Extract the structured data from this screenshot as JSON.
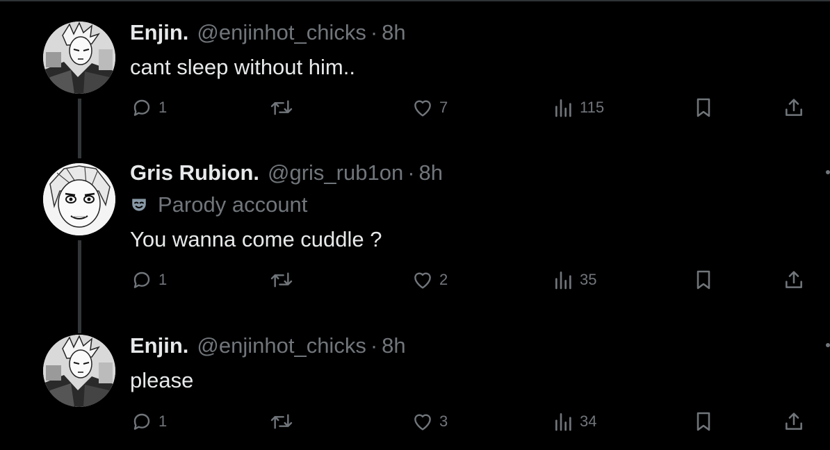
{
  "tweets": [
    {
      "name": "Enjin.",
      "handle": "@enjinhot_chicks",
      "separator": "·",
      "time": "8h",
      "text": "cant sleep without him..",
      "replies": "1",
      "likes": "7",
      "views": "115",
      "avatar": "enjin-avatar"
    },
    {
      "name": "Gris Rubion.",
      "handle": "@gris_rub1on",
      "separator": "·",
      "time": "8h",
      "badge": "Parody account",
      "text": "You wanna come cuddle ?",
      "replies": "1",
      "likes": "2",
      "views": "35",
      "avatar": "gris-avatar"
    },
    {
      "name": "Enjin.",
      "handle": "@enjinhot_chicks",
      "separator": "·",
      "time": "8h",
      "text": "please",
      "replies": "1",
      "likes": "3",
      "views": "34",
      "avatar": "enjin-avatar"
    }
  ],
  "icons": {
    "reply": "reply-icon",
    "retweet": "retweet-icon",
    "like": "heart-icon",
    "views": "views-icon",
    "bookmark": "bookmark-icon",
    "share": "share-icon",
    "parody": "mask-icon"
  },
  "colors": {
    "background": "#000000",
    "primary_text": "#e7e9ea",
    "secondary_text": "#71767b",
    "thread_line": "#333639"
  }
}
